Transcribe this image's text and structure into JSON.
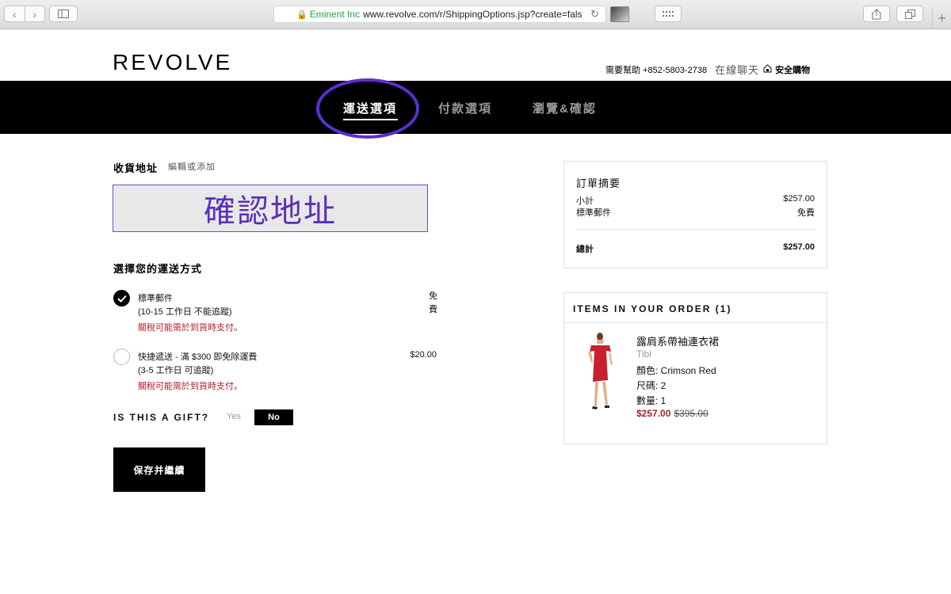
{
  "browser": {
    "url_org": "Eminent Inc",
    "url": "www.revolve.com/r/ShippingOptions.jsp?create=fals"
  },
  "header": {
    "logo": "REVOLVE",
    "help_text": "需要幫助 +852-5803-2738",
    "chat_text": "在線聊天",
    "safe_text": "安全購物"
  },
  "steps": [
    {
      "label": "運送選項",
      "active": true
    },
    {
      "label": "付款選項",
      "active": false
    },
    {
      "label": "瀏覽&確認",
      "active": false
    }
  ],
  "address": {
    "title": "收貨地址",
    "edit_link": "編輯或添加",
    "confirm_label": "確認地址"
  },
  "shipping": {
    "title": "選擇您的運送方式",
    "options": [
      {
        "name": "標準郵件",
        "sub": "(10-15 工作日 不能追蹤)",
        "note": "關稅可能需於到貨時支付。",
        "price": "免費",
        "selected": true
      },
      {
        "name": "快捷遞送 - 滿 $300 即免除運費",
        "sub": "(3-5 工作日 可追蹤)",
        "note": "關稅可能需於到貨時支付。",
        "price": "$20.00",
        "selected": false
      }
    ]
  },
  "gift": {
    "label": "IS THIS A GIFT?",
    "yes": "Yes",
    "no": "No",
    "selected": "No"
  },
  "save_button": "保存并繼續",
  "summary": {
    "title": "訂單摘要",
    "subtotal_label": "小計",
    "subtotal_value": "$257.00",
    "shipping_label": "標準郵件",
    "shipping_value": "免費",
    "total_label": "總計",
    "total_value": "$257.00"
  },
  "items": {
    "header": "ITEMS IN YOUR ORDER (1)",
    "list": [
      {
        "name": "露肩系帶袖連衣裙",
        "brand": "Tibi",
        "color": "顏色: Crimson Red",
        "size": "尺碼: 2",
        "qty": "數量: 1",
        "sale_price": "$257.00",
        "orig_price": "$395.00"
      }
    ]
  },
  "colors": {
    "accent_annotation": "#5b2fd1",
    "sale_red": "#a8212b",
    "note_red": "#b3202a",
    "dress": "#c8202e"
  }
}
